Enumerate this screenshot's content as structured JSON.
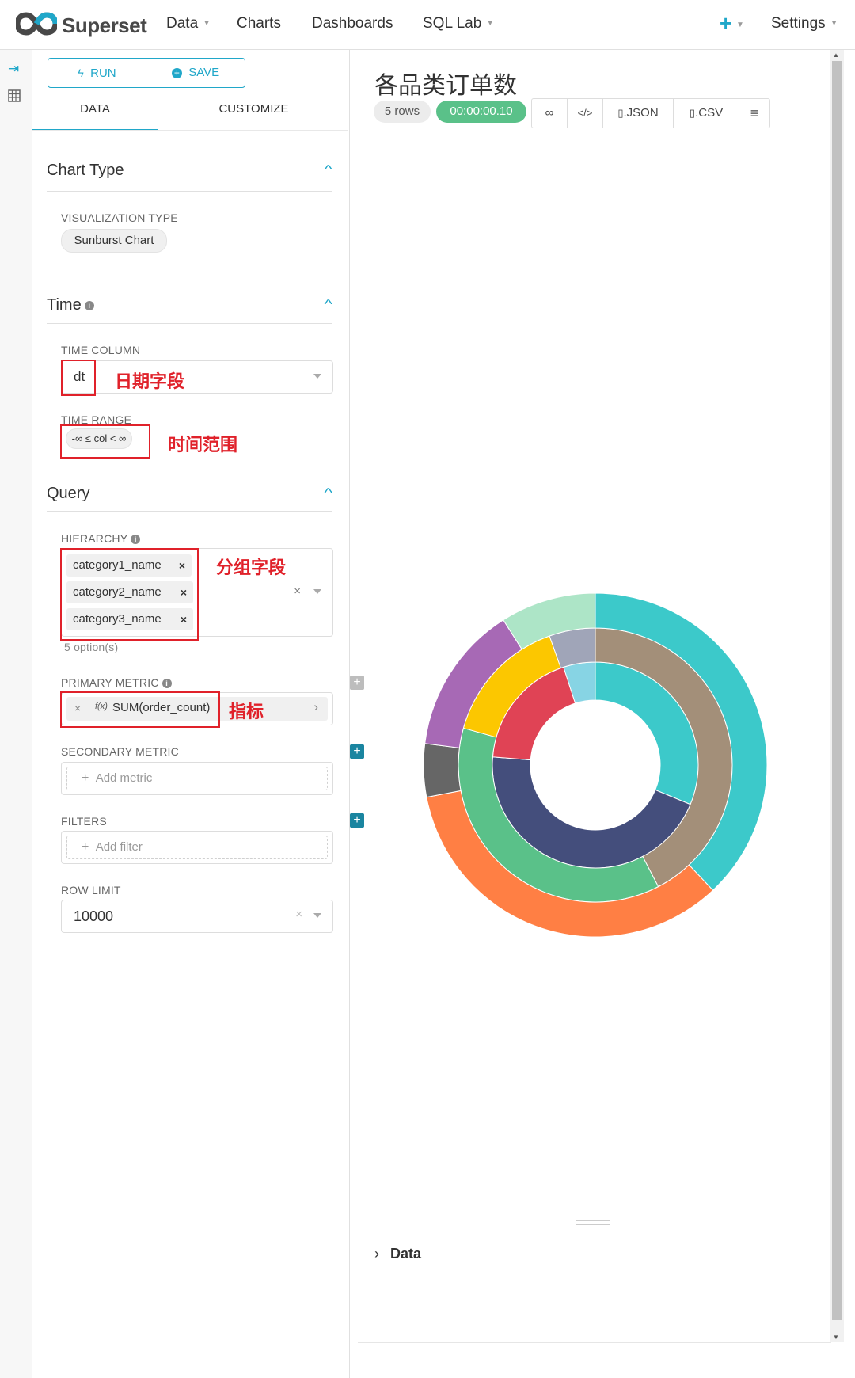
{
  "nav": {
    "brand": "Superset",
    "items": [
      {
        "label": "Data",
        "has_caret": true
      },
      {
        "label": "Charts",
        "has_caret": false
      },
      {
        "label": "Dashboards",
        "has_caret": false
      },
      {
        "label": "SQL Lab",
        "has_caret": true
      }
    ],
    "plus_icon": "plus-icon",
    "settings": "Settings"
  },
  "rail": {
    "icons": [
      "expand-icon",
      "table-icon"
    ]
  },
  "panel": {
    "run_label": "RUN",
    "save_label": "SAVE",
    "tabs": [
      "DATA",
      "CUSTOMIZE"
    ],
    "chart_type": {
      "title": "Chart Type",
      "viz_label": "VISUALIZATION TYPE",
      "viz_value": "Sunburst Chart"
    },
    "time": {
      "title": "Time",
      "column_label": "TIME COLUMN",
      "column_value": "dt",
      "column_note": "日期字段",
      "range_label": "TIME RANGE",
      "range_value": "-∞ ≤ col < ∞",
      "range_note": "时间范围"
    },
    "query": {
      "title": "Query",
      "hierarchy_label": "HIERARCHY",
      "hierarchy": [
        "category1_name",
        "category2_name",
        "category3_name"
      ],
      "hierarchy_note": "分组字段",
      "options_count": "5 option(s)",
      "primary_metric_label": "PRIMARY METRIC",
      "primary_metric_value": "SUM(order_count)",
      "primary_metric_fx": "f(x)",
      "primary_metric_note": "指标",
      "secondary_metric_label": "SECONDARY METRIC",
      "add_metric": "Add metric",
      "filters_label": "FILTERS",
      "add_filter": "Add filter",
      "row_limit_label": "ROW LIMIT",
      "row_limit_value": "10000"
    }
  },
  "chart": {
    "title": "各品类订单数",
    "rows_badge": "5 rows",
    "time_badge": "00:00:00.10",
    "toolbar": {
      "json": ".JSON",
      "csv": ".CSV"
    },
    "data_toggle": "Data"
  },
  "colors": {
    "accent": "#20a7c9",
    "annotation": "#e0212a",
    "success": "#5ac189"
  },
  "chart_data": {
    "type": "sunburst",
    "rings": [
      {
        "level": "category1_name",
        "segments": [
          {
            "value": 25,
            "color": "#3cc9ca"
          },
          {
            "value": 36,
            "color": "#444e7c"
          },
          {
            "value": 15,
            "color": "#e04355"
          },
          {
            "value": 4,
            "color": "#87d4e4"
          }
        ]
      },
      {
        "level": "category2_name",
        "segments": [
          {
            "value": 39,
            "color": "#a38f79"
          },
          {
            "value": 34,
            "color": "#5ac189"
          },
          {
            "value": 14,
            "color": "#fcc700"
          },
          {
            "value": 5,
            "color": "#a0a5b8"
          }
        ]
      },
      {
        "level": "category3_name",
        "segments": [
          {
            "value": 38,
            "color": "#3cc9ca"
          },
          {
            "value": 34,
            "color": "#ff7f44"
          },
          {
            "value": 5,
            "color": "#666666"
          },
          {
            "value": 14,
            "color": "#a769b5"
          },
          {
            "value": 9,
            "color": "#ade5c7"
          }
        ]
      }
    ]
  }
}
